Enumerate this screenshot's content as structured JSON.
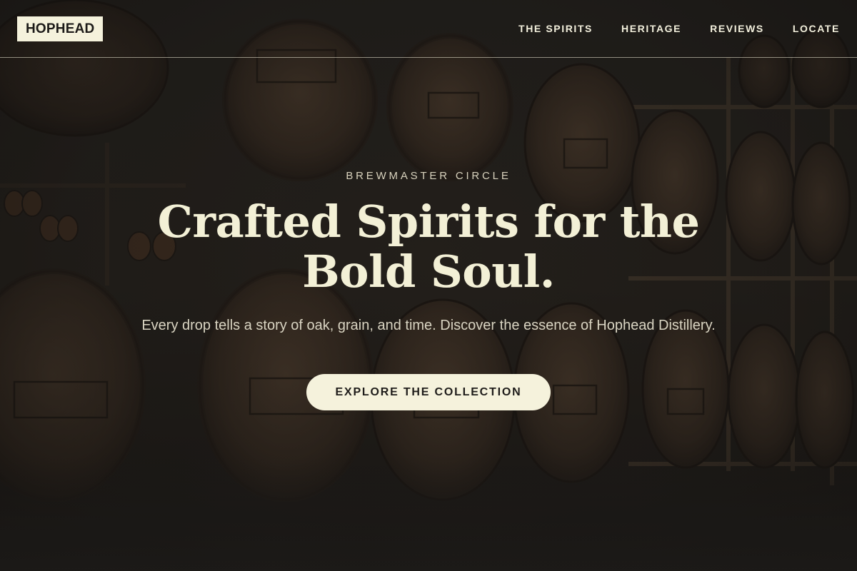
{
  "brand": {
    "logo_text": "HOPHEAD"
  },
  "nav": {
    "items": [
      {
        "label": "THE SPIRITS"
      },
      {
        "label": "HERITAGE"
      },
      {
        "label": "REVIEWS"
      },
      {
        "label": "LOCATE"
      }
    ]
  },
  "hero": {
    "eyebrow": "BREWMASTER CIRCLE",
    "headline_line1": "Crafted Spirits for the",
    "headline_line2": "Bold Soul.",
    "subcopy": "Every drop tells a story of oak, grain, and time. Discover the essence of Hophead Distillery.",
    "cta_label": "EXPLORE THE COLLECTION",
    "background_subject": "barrel-warehouse-image"
  },
  "colors": {
    "cream": "#f5f2dc",
    "headline": "#f3f0d6",
    "dark": "#1c1a18"
  }
}
